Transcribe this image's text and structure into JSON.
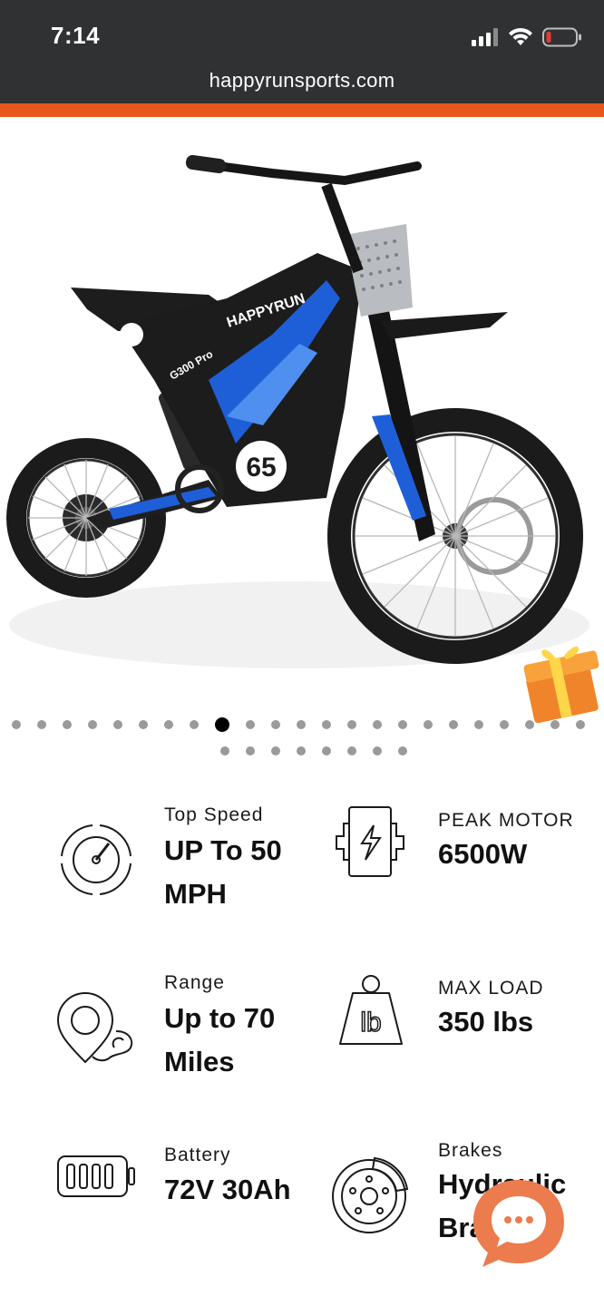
{
  "status_bar": {
    "time": "7:14"
  },
  "browser": {
    "url": "happyrunsports.com"
  },
  "hero": {
    "brand_text": "HAPPYRUN",
    "model_text": "G300 Pro",
    "number_text": "65"
  },
  "carousel": {
    "total_dots": 31,
    "active_index": 8
  },
  "features": [
    {
      "title": "Top Speed",
      "value_line1": "UP To 50",
      "value_line2": "MPH",
      "icon": "speedometer-icon"
    },
    {
      "title": "PEAK MOTOR",
      "value_line1": "6500W",
      "value_line2": "",
      "icon": "motor-icon"
    },
    {
      "title": "Range",
      "value_line1": "Up to 70",
      "value_line2": "Miles",
      "icon": "map-pin-icon"
    },
    {
      "title": "MAX LOAD",
      "value_line1": "350 lbs",
      "value_line2": "",
      "icon": "weight-icon"
    },
    {
      "title": "Battery",
      "value_line1": "72V 30Ah",
      "value_line2": "",
      "icon": "battery-icon"
    },
    {
      "title": "Brakes",
      "value_line1": "Hydraulic",
      "value_line2": "Brakes",
      "icon": "brake-disc-icon"
    }
  ],
  "colors": {
    "accent": "#e8581c",
    "topbar": "#2f3132",
    "bike_blue": "#1e5fd8",
    "chat_bubble": "#ec7b4e"
  },
  "chat": {
    "icon": "chat-bubble-icon"
  }
}
